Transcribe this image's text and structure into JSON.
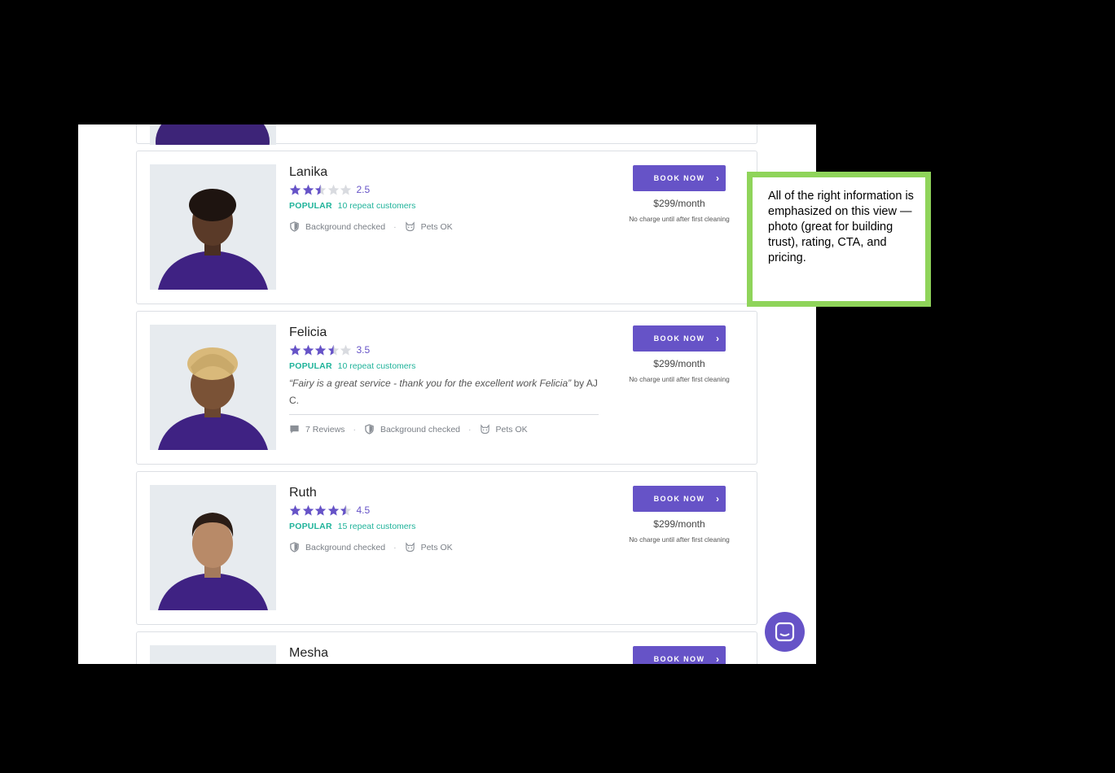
{
  "cleaners": [
    {
      "name": "Lanika",
      "rating_value": 2.5,
      "rating_text": "2.5",
      "popular_label": "POPULAR",
      "repeat_customers": "10 repeat customers",
      "badges": [
        "Background checked",
        "Pets OK"
      ],
      "book_label": "BOOK NOW",
      "price": "$299/month",
      "price_note": "No charge until after first cleaning"
    },
    {
      "name": "Felicia",
      "rating_value": 3.5,
      "rating_text": "3.5",
      "popular_label": "POPULAR",
      "repeat_customers": "10 repeat customers",
      "review_quote": "“Fairy is a great service - thank you for the excellent work Felicia”",
      "review_by": " by",
      "review_author": "AJ C.",
      "reviews_count": "7 Reviews",
      "badges": [
        "Background checked",
        "Pets OK"
      ],
      "book_label": "BOOK NOW",
      "price": "$299/month",
      "price_note": "No charge until after first cleaning"
    },
    {
      "name": "Ruth",
      "rating_value": 4.5,
      "rating_text": "4.5",
      "popular_label": "POPULAR",
      "repeat_customers": "15 repeat customers",
      "badges": [
        "Background checked",
        "Pets OK"
      ],
      "book_label": "BOOK NOW",
      "price": "$299/month",
      "price_note": "No charge until after first cleaning"
    },
    {
      "name": "Mesha",
      "book_label": "BOOK NOW"
    }
  ],
  "annotation": {
    "text": "All of the right information is emphasized on this view — photo (great for building trust), rating, CTA, and pricing."
  },
  "colors": {
    "brand": "#6653c7",
    "popular": "#1fb39a",
    "callout_border": "#8fd45a"
  },
  "icons": {
    "chevron": "chevron-right-icon",
    "background": "shield-icon",
    "pets": "cat-icon",
    "reviews": "comment-icon",
    "chat": "chat-icon"
  }
}
